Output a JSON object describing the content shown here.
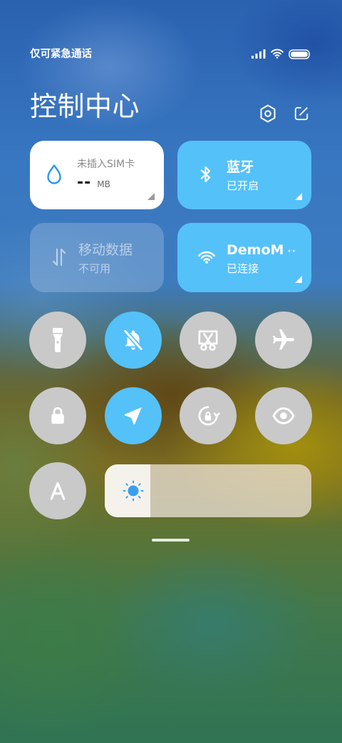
{
  "status_bar": {
    "carrier_text": "仅可紧急通话",
    "icons": [
      "signal-icon",
      "wifi-icon",
      "battery-icon"
    ]
  },
  "header": {
    "title": "控制中心",
    "actions": [
      "settings-icon",
      "edit-icon"
    ]
  },
  "tiles": {
    "data_usage": {
      "label": "未插入SIM卡",
      "value": "--",
      "unit": "MB",
      "icon": "water-drop-icon"
    },
    "bluetooth": {
      "title": "蓝牙",
      "status": "已开启",
      "active": true,
      "icon": "bluetooth-icon"
    },
    "mobile_data": {
      "title": "移动数据",
      "status": "不可用",
      "active": false,
      "icon": "mobile-data-icon"
    },
    "wifi": {
      "title": "DemoM",
      "title_overflow": "··",
      "status": "已连接",
      "active": true,
      "icon": "wifi-icon"
    }
  },
  "toggles": [
    {
      "icon": "flashlight-icon",
      "active": false
    },
    {
      "icon": "mute-icon",
      "active": true
    },
    {
      "icon": "screenshot-icon",
      "active": false
    },
    {
      "icon": "airplane-mode-icon",
      "active": false
    },
    {
      "icon": "screen-lock-icon",
      "active": false
    },
    {
      "icon": "location-icon",
      "active": true
    },
    {
      "icon": "rotation-lock-icon",
      "active": false
    },
    {
      "icon": "reading-mode-icon",
      "active": false
    }
  ],
  "brightness": {
    "level": 0.22,
    "auto": false,
    "icon": "sun-icon",
    "auto_icon": "auto-brightness-icon"
  },
  "colors": {
    "accent": "#55c1f9",
    "toggle_off": "#c9c9c9",
    "drop_icon": "#2b97ef",
    "sun_icon": "#3a9ef0"
  }
}
